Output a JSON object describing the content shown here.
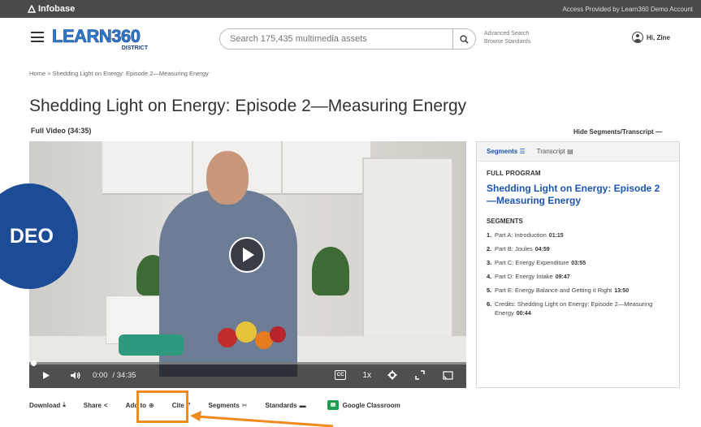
{
  "topbar": {
    "brand": "Infobase",
    "access_text": "Access Provided by Learn360 Demo Account"
  },
  "header": {
    "logo_text": "LEARN360",
    "logo_sub": "DISTRICT",
    "search_placeholder": "Search 175,435 multimedia assets",
    "advanced_search": "Advanced Search",
    "browse_standards": "Browse Standards",
    "user_greeting": "Hi, Zine"
  },
  "breadcrumb": "Home > Shedding Light on Energy: Episode 2—Measuring Energy",
  "page": {
    "title": "Shedding Light on Energy: Episode 2—Measuring Energy",
    "subtitle": "Full Video (34:35)",
    "hide_segments": "Hide Segments/Transcript"
  },
  "player": {
    "current_time": "0:00",
    "duration": "/ 34:35",
    "cc_label": "CC",
    "speed": "1x",
    "progress": 0.0
  },
  "panel": {
    "tab_segments": "Segments",
    "tab_transcript": "Transcript",
    "full_program_label": "FULL PROGRAM",
    "program_title": "Shedding Light on Energy: Episode 2—Measuring Energy",
    "segments_label": "SEGMENTS",
    "segments": [
      {
        "num": "1.",
        "title": "Part A: Introduction",
        "duration": "01:15"
      },
      {
        "num": "2.",
        "title": "Part B: Joules",
        "duration": "04:59"
      },
      {
        "num": "3.",
        "title": "Part C: Energy Expenditure",
        "duration": "03:55"
      },
      {
        "num": "4.",
        "title": "Part D: Energy Intake",
        "duration": "09:47"
      },
      {
        "num": "5.",
        "title": "Part E: Energy Balance and Getting it Right",
        "duration": "13:50"
      },
      {
        "num": "6.",
        "title": "Credits: Shedding Light on Energy: Episode 2—Measuring Energy",
        "duration": "00:44"
      }
    ]
  },
  "toolbar": {
    "download": "Download",
    "share": "Share",
    "add_to": "Add to",
    "cite": "Cite",
    "segments": "Segments",
    "standards": "Standards",
    "google_classroom": "Google Classroom"
  },
  "overlay": {
    "badge_text": "DEO"
  },
  "colors": {
    "accent": "#1b55b0",
    "highlight": "#ef8b1f",
    "badge": "#1c4c96"
  }
}
